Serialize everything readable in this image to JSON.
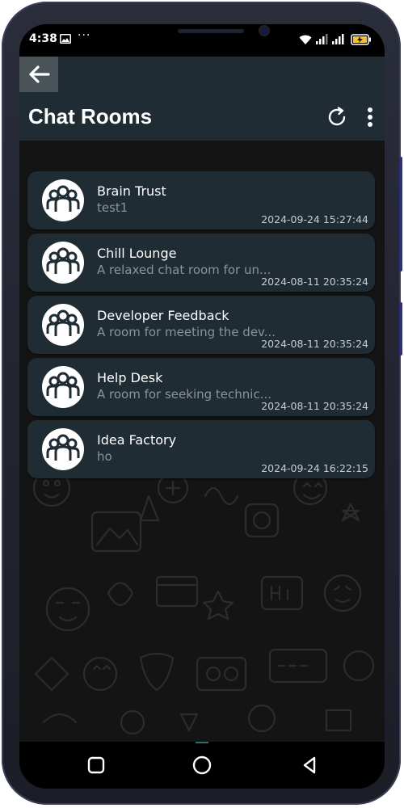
{
  "status_bar": {
    "time": "4:38",
    "more": "···",
    "icons": [
      "gallery-icon",
      "wifi-icon",
      "signal-icon",
      "signal-icon",
      "battery-charging-icon"
    ]
  },
  "app_bar": {
    "back_icon": "arrow-left-icon",
    "title": "Chat Rooms",
    "actions": [
      "refresh-icon",
      "more-vertical-icon"
    ]
  },
  "rooms": [
    {
      "name": "Brain Trust",
      "description": "test1",
      "timestamp": "2024-09-24 15:27:44"
    },
    {
      "name": "Chill Lounge",
      "description": "A relaxed chat room for un...",
      "timestamp": "2024-08-11 20:35:24"
    },
    {
      "name": "Developer Feedback",
      "description": "A room for meeting the dev...",
      "timestamp": "2024-08-11 20:35:24"
    },
    {
      "name": "Help Desk",
      "description": "A room for seeking technic...",
      "timestamp": "2024-08-11 20:35:24"
    },
    {
      "name": "Idea Factory",
      "description": "ho",
      "timestamp": "2024-09-24 16:22:15"
    }
  ],
  "nav_bar": {
    "buttons": [
      "recents-square-icon",
      "home-circle-icon",
      "back-triangle-icon"
    ]
  },
  "colors": {
    "app_bar": "#1f2c34",
    "card": "#1f2c34",
    "background": "#141414",
    "subtext": "#8a9499"
  }
}
